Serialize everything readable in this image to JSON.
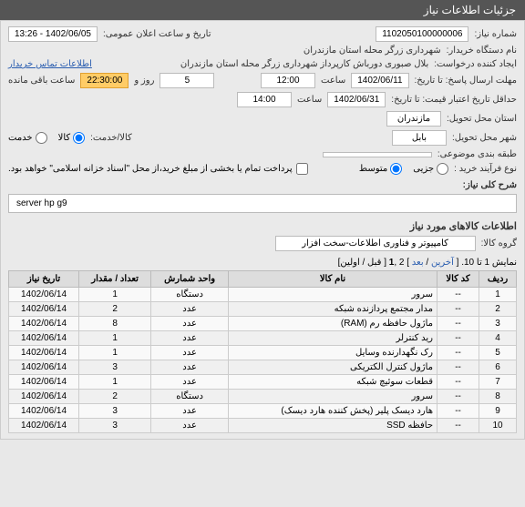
{
  "header": {
    "title": "جزئیات اطلاعات نیاز"
  },
  "form": {
    "need_no_label": "شماره نیاز:",
    "need_no": "1102050100000006",
    "pub_datetime_label": "تاریخ و ساعت اعلان عمومی:",
    "pub_datetime": "1402/06/05 - 13:26",
    "buyer_label": "نام دستگاه خریدار:",
    "buyer": "شهرداری زرگر محله استان مازندران",
    "creator_label": "ایجاد کننده درخواست:",
    "creator": "بلال صبوری دورباش کارپرداز شهرداری زرگر محله استان مازندران",
    "contact_link": "اطلاعات تماس خریدار",
    "deadline_label": "مهلت ارسال پاسخ: تا تاریخ:",
    "deadline_date": "1402/06/11",
    "hour_label": "ساعت",
    "deadline_hour": "12:00",
    "days_left": "5",
    "days_left_suffix": "روز و",
    "time_left": "22:30:00",
    "time_left_suffix": "ساعت باقی مانده",
    "valid_label": "حداقل تاریخ اعتبار قیمت: تا تاریخ:",
    "valid_date": "1402/06/31",
    "valid_hour": "14:00",
    "province_label": "استان محل تحویل:",
    "province": "مازندران",
    "city_label": "شهر محل تحویل:",
    "city": "بابل",
    "goods_service_label": "کالا/خدمت:",
    "opt_goods": "کالا",
    "opt_service": "خدمت",
    "grouping_label": "طبقه بندی موضوعی:",
    "buy_type_label": "نوع فرآیند خرید :",
    "opt_partial": "جزیی",
    "opt_medium": "متوسط",
    "payment_note": "پرداخت تمام یا بخشی از مبلغ خرید،از محل \"اسناد خزانه اسلامی\" خواهد بود.",
    "desc_label": "شرح کلی نیاز:",
    "desc": "server hp g9",
    "goods_info_title": "اطلاعات کالاهای مورد نیاز",
    "group_label": "گروه کالا:",
    "group": "کامپیوتر و فناوری اطلاعات-سخت افزار"
  },
  "pager": {
    "prefix": "نمایش 1 تا 10. [ ",
    "last": "آخرین",
    "sep1": " / ",
    "next": "بعد",
    "mid": " ] 2 ,",
    "current": "1",
    "suffix": " [ قبل / اولین]"
  },
  "table": {
    "headers": [
      "ردیف",
      "کد کالا",
      "نام کالا",
      "واحد شمارش",
      "تعداد / مقدار",
      "تاریخ نیاز"
    ],
    "rows": [
      {
        "n": "1",
        "code": "--",
        "name": "سرور",
        "unit": "دستگاه",
        "qty": "1",
        "date": "1402/06/14"
      },
      {
        "n": "2",
        "code": "--",
        "name": "مدار مجتمع پردازنده شبکه",
        "unit": "عدد",
        "qty": "2",
        "date": "1402/06/14"
      },
      {
        "n": "3",
        "code": "--",
        "name": "ماژول حافظه رم (RAM)",
        "unit": "عدد",
        "qty": "8",
        "date": "1402/06/14"
      },
      {
        "n": "4",
        "code": "--",
        "name": "رید کنترلر",
        "unit": "عدد",
        "qty": "1",
        "date": "1402/06/14"
      },
      {
        "n": "5",
        "code": "--",
        "name": "رک نگهدارنده وسایل",
        "unit": "عدد",
        "qty": "1",
        "date": "1402/06/14"
      },
      {
        "n": "6",
        "code": "--",
        "name": "ماژول کنترل الکتریکی",
        "unit": "عدد",
        "qty": "3",
        "date": "1402/06/14"
      },
      {
        "n": "7",
        "code": "--",
        "name": "قطعات سوئیچ شبکه",
        "unit": "عدد",
        "qty": "1",
        "date": "1402/06/14"
      },
      {
        "n": "8",
        "code": "--",
        "name": "سرور",
        "unit": "دستگاه",
        "qty": "2",
        "date": "1402/06/14"
      },
      {
        "n": "9",
        "code": "--",
        "name": "هارد دیسک پلیر (پخش کننده هارد دیسک)",
        "unit": "عدد",
        "qty": "3",
        "date": "1402/06/14"
      },
      {
        "n": "10",
        "code": "--",
        "name": "حافظه SSD",
        "unit": "عدد",
        "qty": "3",
        "date": "1402/06/14"
      }
    ]
  }
}
